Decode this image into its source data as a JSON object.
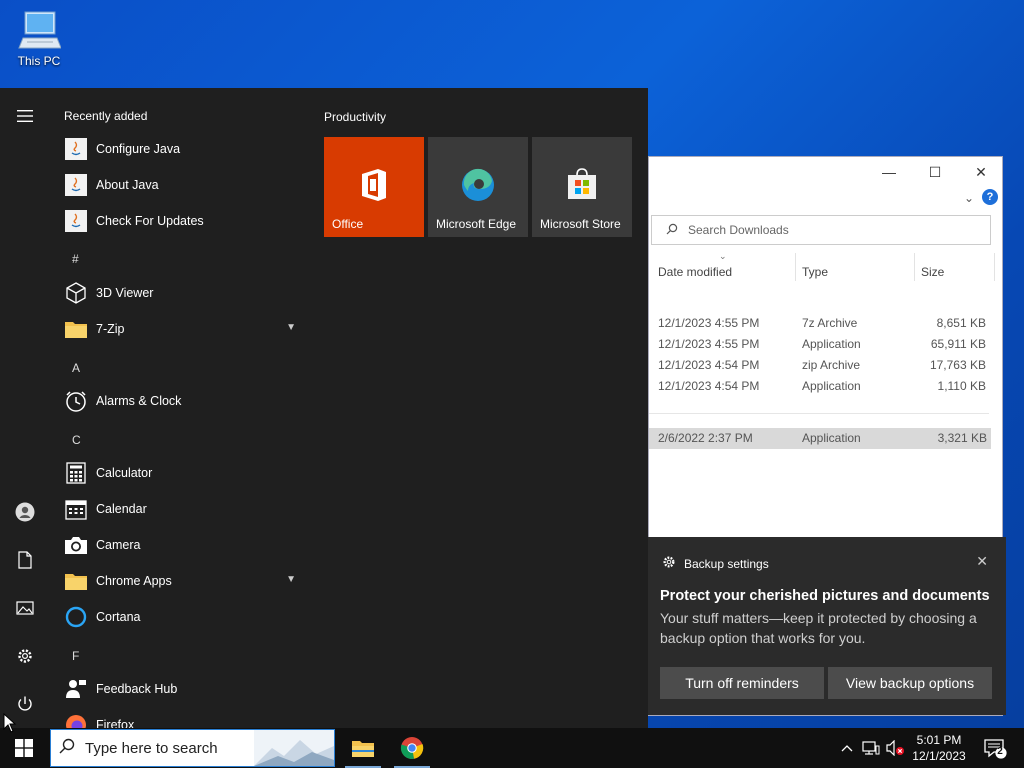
{
  "desktop": {
    "this_pc_label": "This PC"
  },
  "explorer": {
    "search_placeholder": "Search Downloads",
    "columns": {
      "date": "Date modified",
      "type": "Type",
      "size": "Size"
    },
    "rows": [
      {
        "date": "12/1/2023 4:55 PM",
        "type": "7z Archive",
        "size": "8,651 KB"
      },
      {
        "date": "12/1/2023 4:55 PM",
        "type": "Application",
        "size": "65,911 KB"
      },
      {
        "date": "12/1/2023 4:54 PM",
        "type": "zip Archive",
        "size": "17,763 KB"
      },
      {
        "date": "12/1/2023 4:54 PM",
        "type": "Application",
        "size": "1,110 KB"
      }
    ],
    "selected_row": {
      "date": "2/6/2022 2:37 PM",
      "type": "Application",
      "size": "3,321 KB"
    },
    "controls": {
      "minimize": "—",
      "maximize": "☐",
      "close": "✕",
      "help": "?"
    }
  },
  "start_menu": {
    "recently_added_title": "Recently added",
    "recent": [
      "Configure Java",
      "About Java",
      "Check For Updates"
    ],
    "letters": {
      "hash": "#",
      "a": "A",
      "c": "C",
      "f": "F"
    },
    "apps": {
      "viewer3d": "3D Viewer",
      "zip7": "7-Zip",
      "alarms": "Alarms & Clock",
      "calculator": "Calculator",
      "calendar": "Calendar",
      "camera": "Camera",
      "chrome_apps": "Chrome Apps",
      "cortana": "Cortana",
      "feedback": "Feedback Hub",
      "firefox": "Firefox"
    },
    "productivity_title": "Productivity",
    "tiles": [
      {
        "label": "Office",
        "color": "#d83b01"
      },
      {
        "label": "Microsoft Edge",
        "color": "#3a3a3a"
      },
      {
        "label": "Microsoft Store",
        "color": "#3a3a3a"
      }
    ]
  },
  "toast": {
    "app_name": "Backup settings",
    "title": "Protect your cherished pictures and documents",
    "body": "Your stuff matters—keep it protected by choosing a backup option that works for you.",
    "button_left": "Turn off reminders",
    "button_right": "View backup options"
  },
  "taskbar": {
    "search_placeholder": "Type here to search",
    "time": "5:01 PM",
    "date": "12/1/2023",
    "notification_count": "2"
  }
}
